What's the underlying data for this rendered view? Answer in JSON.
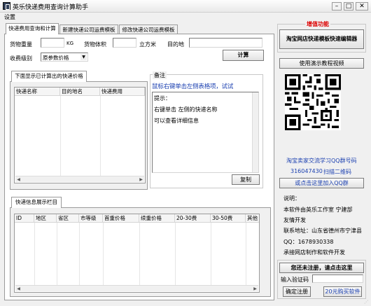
{
  "window": {
    "title": "英乐快递费用查询计算助手",
    "controls": {
      "minimize": "–",
      "maximize": "□",
      "close": "✕"
    }
  },
  "menu": {
    "settings": "设置"
  },
  "tabs": [
    {
      "label": "快递费用查询和计算",
      "active": true
    },
    {
      "label": "新建快递公司运费模板",
      "active": false
    },
    {
      "label": "修改快递公司运费模板",
      "active": false
    }
  ],
  "form": {
    "weight_label": "货物重量",
    "weight_unit": "KG",
    "volume_label": "货物体积",
    "volume_unit": "立方米",
    "destination_label": "目的地",
    "level_label": "收费级别",
    "level_value": "原参数价格",
    "calc_button": "计算"
  },
  "results": {
    "tab_label": "下面显示已计算出的快递价格",
    "columns": [
      "快递名称",
      "目的地名",
      "快递费用"
    ]
  },
  "notes": {
    "group_title": "备注",
    "hint": "鼠标右键单击左侧表格项，试试",
    "tip_lines": [
      "提示：",
      "右键单击  左侧的快递名称",
      "可以查看详细信息"
    ],
    "copy_button": "复制"
  },
  "info": {
    "tab_label": "快递信息展示栏目",
    "columns": [
      "ID",
      "地区",
      "省区",
      "市等级",
      "首重价格",
      "续重价格",
      "20-30费",
      "30-50费",
      "其他"
    ]
  },
  "sidebar": {
    "addon_title": "增值功能",
    "editor_button": "淘宝网店快递模板快速编辑器",
    "video_button": "使用演示教程视频",
    "qq_group_label": "淘宝卖家交流学习QQ群号码",
    "qq_group_number": "316047430",
    "scan_label": "扫描二维码",
    "join_group_link": "或点击这里加入QQ群",
    "about_lines": [
      "说明：",
      "本软件由英乐工作室 宁建部",
      "友情开发",
      "联系地址：山东省德州市宁津县",
      "QQ：1678930338",
      "承接网店制作和软件开发"
    ],
    "register_prompt": "您还未注册，请点击这里",
    "code_label": "输入验证码",
    "confirm_button": "确定注册",
    "buy_button": "20元购买软件"
  },
  "colors": {
    "title_red": "#dd0000",
    "link_blue": "#1a3fb0"
  }
}
